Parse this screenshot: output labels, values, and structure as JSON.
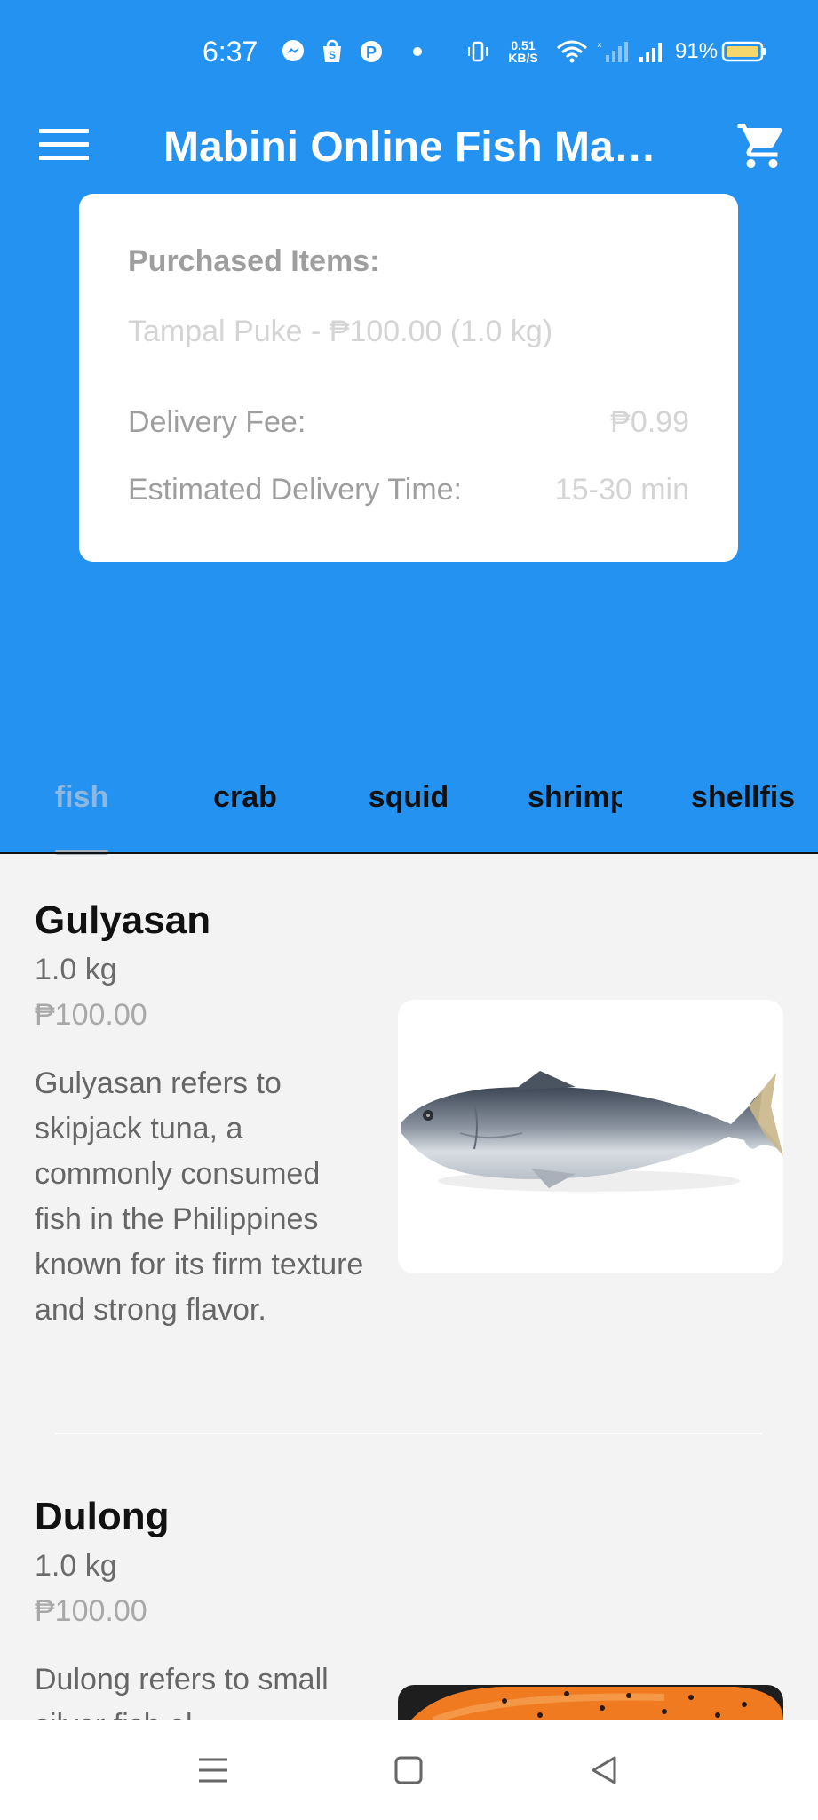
{
  "status_bar": {
    "time": "6:37",
    "net_speed_value": "0.51",
    "net_speed_unit": "KB/S",
    "battery": "91%",
    "icons": [
      "messenger-icon",
      "shopee-icon",
      "pinterest-icon",
      "dot-icon",
      "vibrate-icon",
      "wifi-icon",
      "no-signal-icon",
      "signal-icon",
      "battery-icon"
    ]
  },
  "app_bar": {
    "title": "Mabini Online Fish Mar…",
    "menu_icon": "hamburger-menu-icon",
    "cart_icon": "shopping-cart-icon"
  },
  "summary": {
    "heading": "Purchased Items:",
    "item_line": "Tampal Puke - ₱100.00 (1.0 kg)",
    "delivery_fee_label": "Delivery Fee:",
    "delivery_fee_value": "₱0.99",
    "delivery_time_label": "Estimated Delivery Time:",
    "delivery_time_value": "15-30 min"
  },
  "tabs": [
    {
      "label": "fish",
      "active": true
    },
    {
      "label": "crab",
      "active": false
    },
    {
      "label": "squid",
      "active": false
    },
    {
      "label": "shrimp",
      "active": false
    },
    {
      "label": "shellfish",
      "active": false
    }
  ],
  "products": [
    {
      "name": "Gulyasan",
      "weight": "1.0 kg",
      "price": "₱100.00",
      "description": "Gulyasan refers to skipjack tuna, a commonly consumed fish in the Philippines known for its firm texture and strong flavor.",
      "image": "skipjack-tuna-image"
    },
    {
      "name": "Dulong",
      "weight": "1.0 kg",
      "price": "₱100.00",
      "description": "Dulong refers to small silver fish ol",
      "image": "dulong-in-orange-basin-image"
    }
  ],
  "nav_bar": {
    "icons": [
      "recents-icon",
      "home-icon",
      "back-icon"
    ]
  },
  "colors": {
    "primary": "#2492f0",
    "background": "#f3f3f3",
    "card": "#ffffff"
  }
}
